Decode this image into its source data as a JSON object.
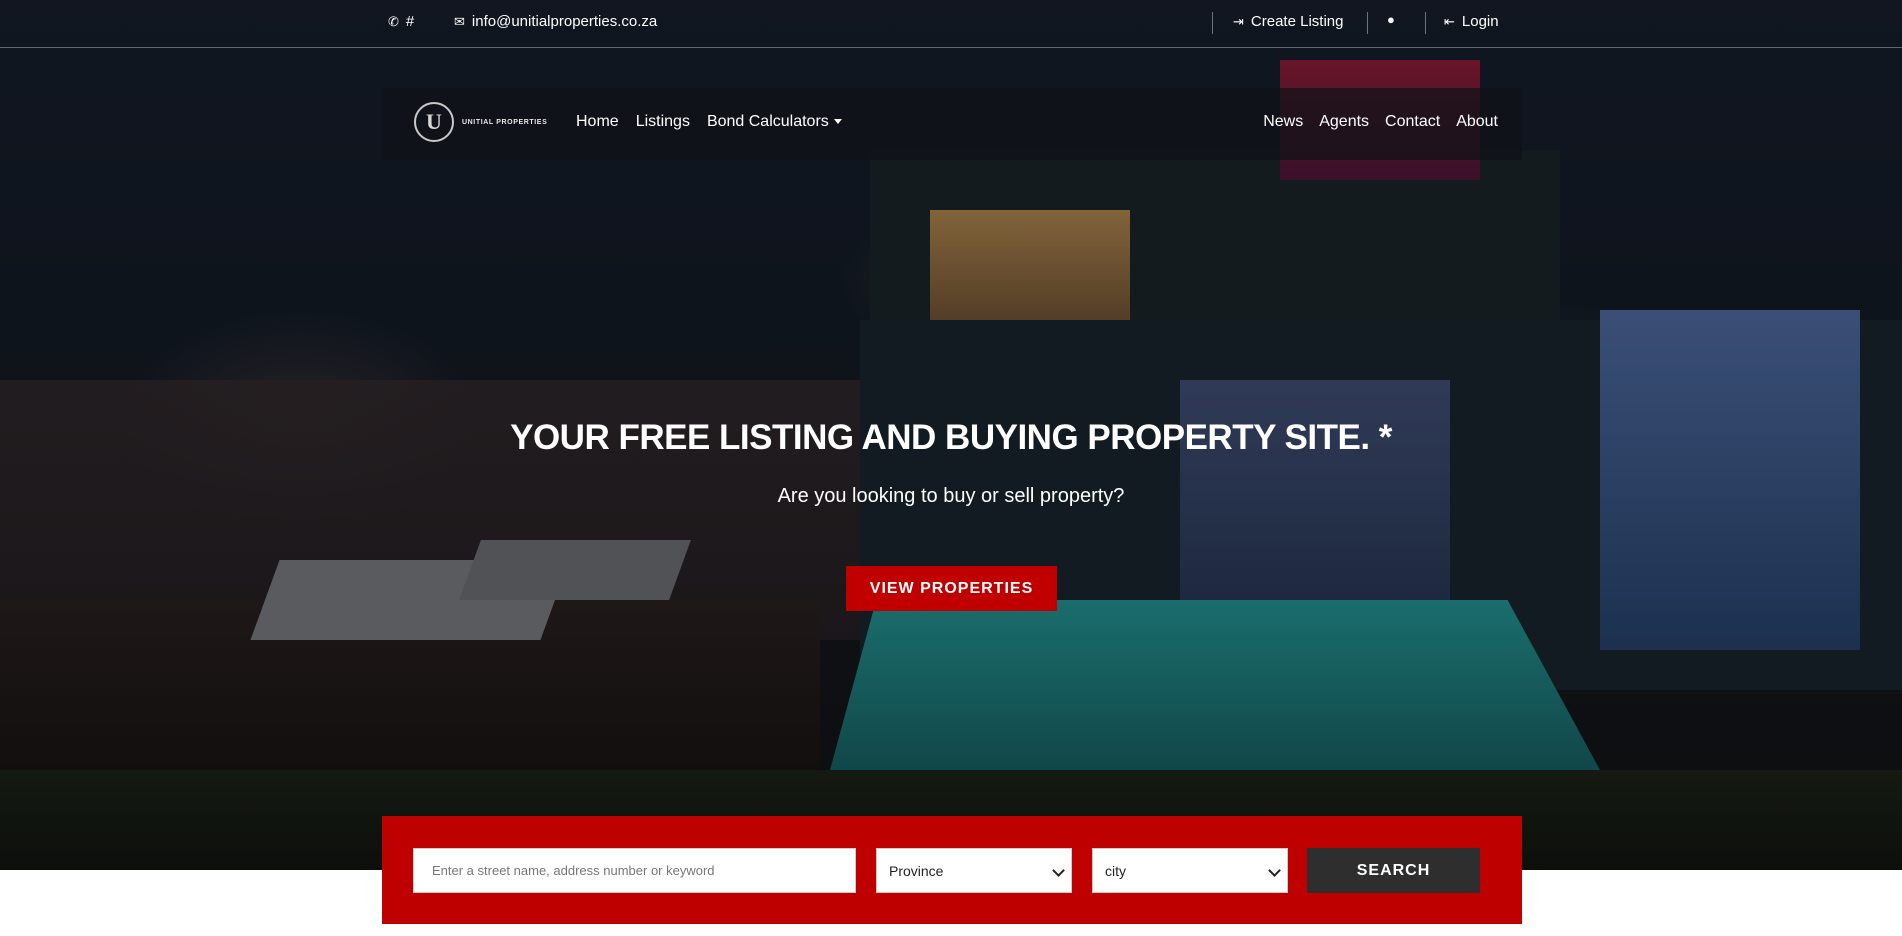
{
  "topbar": {
    "whatsapp_text": "#",
    "email": "info@unitialproperties.co.za",
    "create_listing": "Create Listing",
    "login": "Login"
  },
  "nav": {
    "logo_text": "UNITIAL PROPERTIES",
    "logo_mark": "U",
    "home": "Home",
    "listings": "Listings",
    "bond_calculators": "Bond Calculators",
    "news": "News",
    "agents": "Agents",
    "contact": "Contact",
    "about": "About"
  },
  "hero": {
    "title": "YOUR FREE LISTING AND BUYING PROPERTY SITE. *",
    "subtitle": "Are you looking to buy or sell property?",
    "cta": "VIEW PROPERTIES"
  },
  "search": {
    "placeholder": "Enter a street name, address number or keyword",
    "province": "Province",
    "city": "city",
    "button": "SEARCH"
  },
  "colors": {
    "accent_red": "#be0000",
    "button_dark": "#2e2e2e"
  },
  "icons": {
    "whatsapp": "whatsapp-icon",
    "email": "envelope-icon",
    "create_listing": "sign-in-icon",
    "user": "user-icon",
    "login": "sign-out-icon"
  }
}
